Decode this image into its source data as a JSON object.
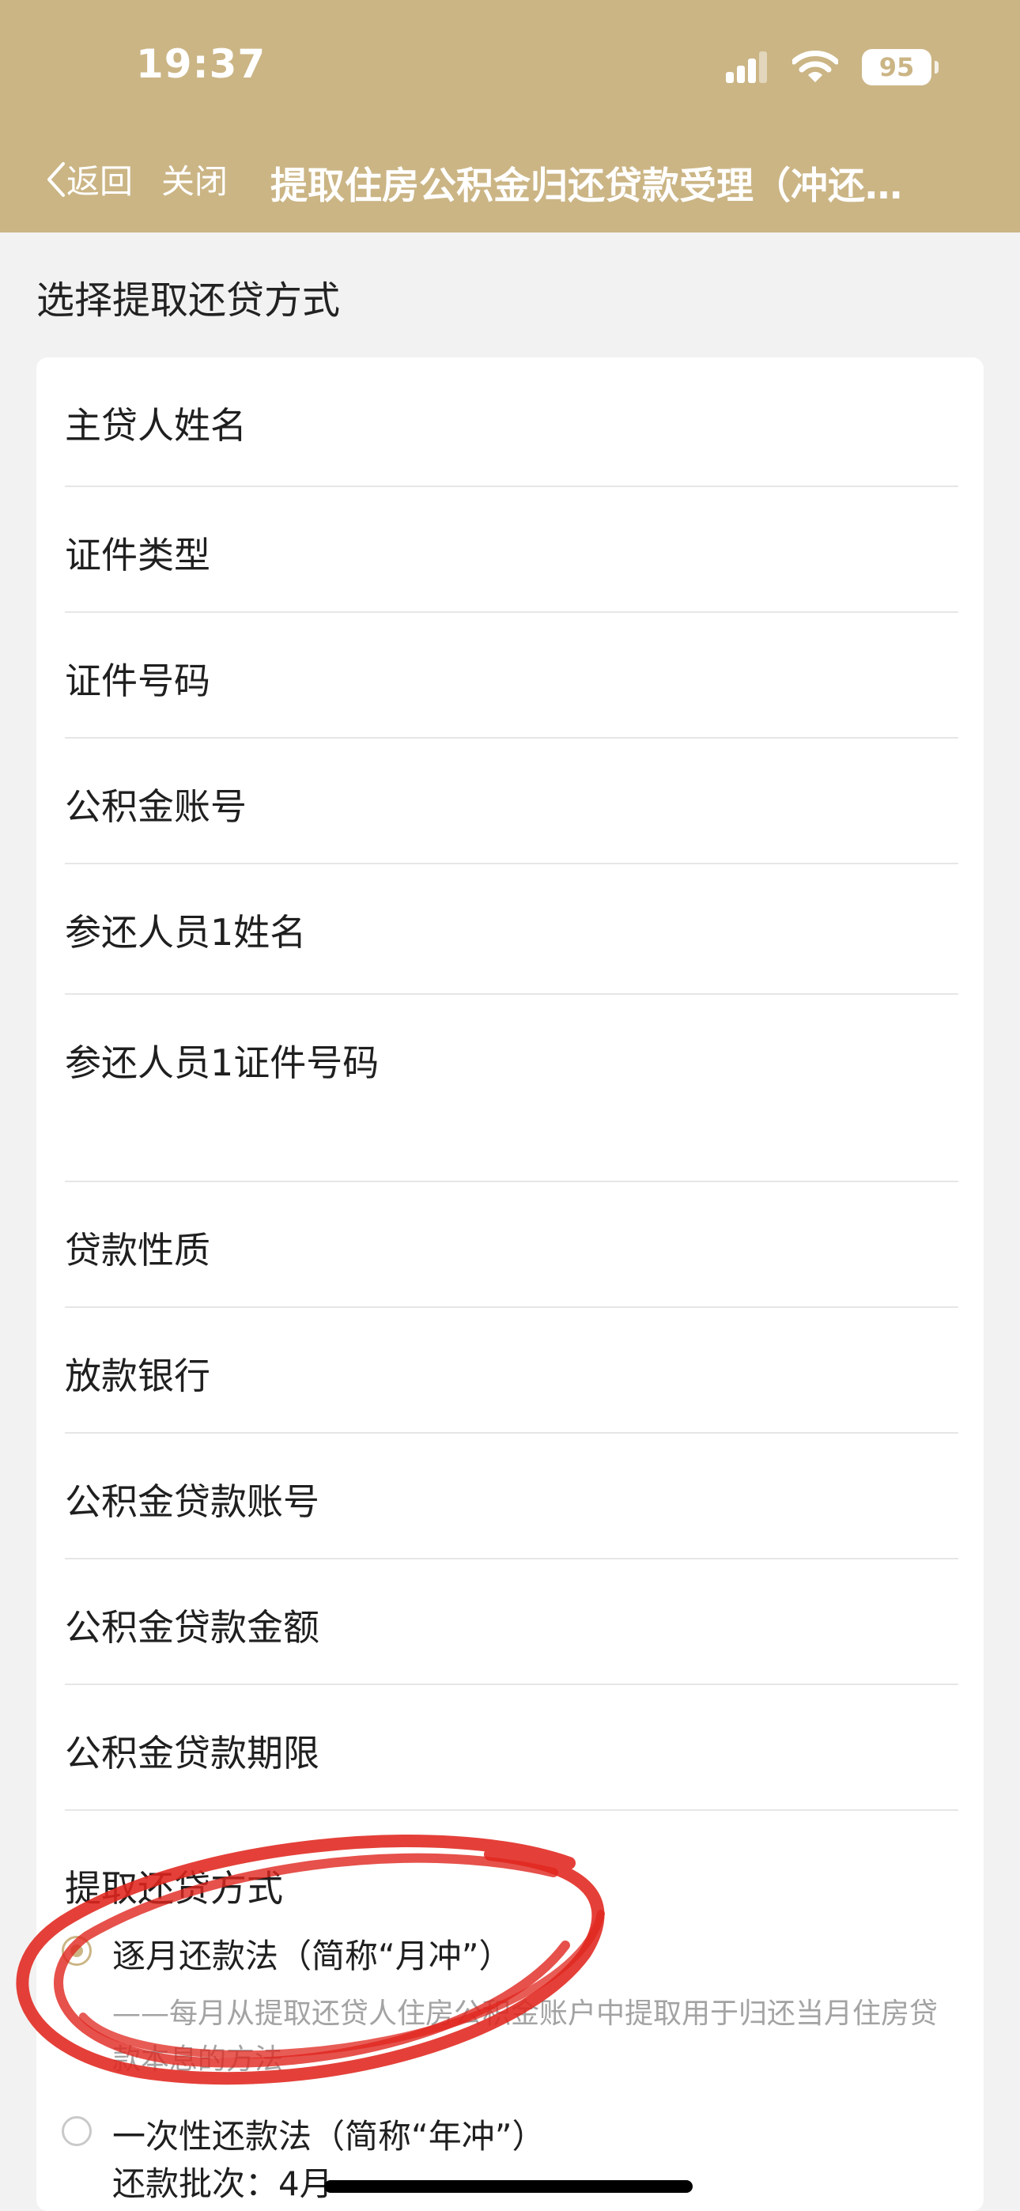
{
  "status_bar": {
    "time": "19:37",
    "battery": "95"
  },
  "nav": {
    "back_label": "返回",
    "close_label": "关闭",
    "title": "提取住房公积金归还贷款受理（冲还…"
  },
  "section_title": "选择提取还贷方式",
  "fields": [
    {
      "label": "主贷人姓名"
    },
    {
      "label": "证件类型"
    },
    {
      "label": "证件号码"
    },
    {
      "label": "公积金账号"
    },
    {
      "label": "参还人员1姓名"
    },
    {
      "label": "参还人员1证件号码"
    },
    {
      "label": "贷款性质"
    },
    {
      "label": "放款银行"
    },
    {
      "label": "公积金贷款账号"
    },
    {
      "label": "公积金贷款金额"
    },
    {
      "label": "公积金贷款期限"
    }
  ],
  "repayment": {
    "label": "提取还贷方式",
    "options": [
      {
        "label": "逐月还款法（简称“月冲”）",
        "description": "——每月从提取还贷人住房公积金账户中提取用于归还当月住房贷款本息的方法",
        "selected": true
      },
      {
        "label": "一次性还款法（简称“年冲”）",
        "batch": "还款批次：4月",
        "selected": false
      }
    ]
  },
  "colors": {
    "header": "#cbb585",
    "accent": "#cbb585",
    "annotation": "#e0261e"
  }
}
